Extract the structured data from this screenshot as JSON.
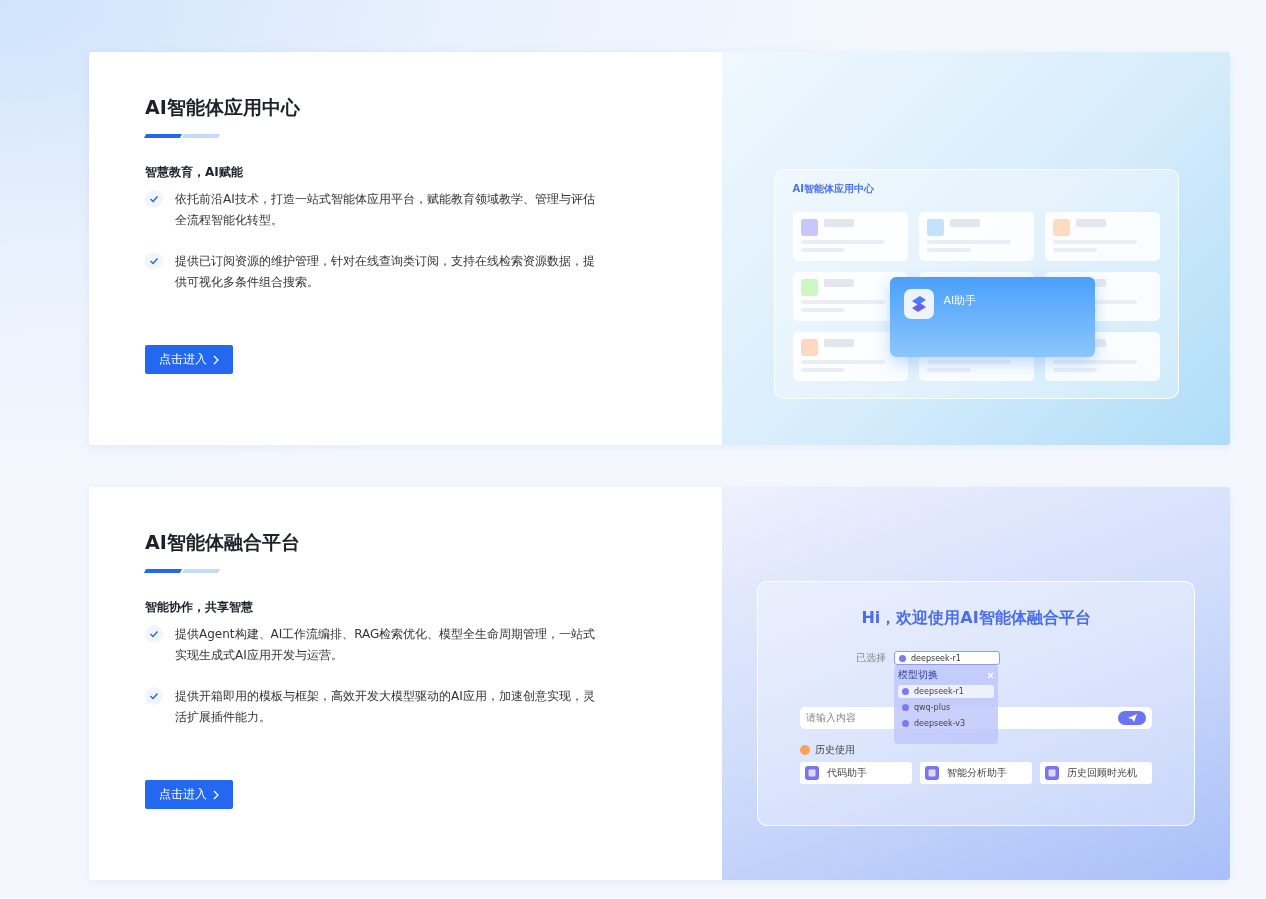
{
  "sections": [
    {
      "title": "AI智能体应用中心",
      "subtitle": "智慧教育，AI赋能",
      "points": [
        "依托前沿AI技术，打造一站式智能体应用平台，赋能教育领域教学、管理与评估全流程智能化转型。",
        "提供已订阅资源的维护管理，针对在线查询类订阅，支持在线检索资源数据，提供可视化多条件组合搜索。"
      ],
      "button": "点击进入",
      "illustration": {
        "kind": "app_grid",
        "heading": "AI智能体应用中心",
        "featured": "AI助手"
      }
    },
    {
      "title": "AI智能体融合平台",
      "subtitle": "智能协作，共享智慧",
      "points": [
        "提供Agent构建、AI工作流编排、RAG检索优化、模型全生命周期管理，一站式实现生成式AI应用开发与运营。",
        "提供开箱即用的模板与框架，高效开发大模型驱动的AI应用，加速创意实现，灵活扩展插件能力。"
      ],
      "button": "点击进入",
      "illustration": {
        "kind": "chat",
        "greeting": "Hi，欢迎使用AI智能体融合平台",
        "selected_label": "已选择",
        "selected_model": "deepseek-r1",
        "dropdown_title": "模型切换",
        "models": [
          {
            "name": "deepseek-r1",
            "selected": true
          },
          {
            "name": "qwq-plus",
            "selected": false
          },
          {
            "name": "deepseek-v3",
            "selected": false
          }
        ],
        "input_placeholder": "请输入内容",
        "history_label": "历史使用",
        "history": [
          "代码助手",
          "智能分析助手",
          "历史回顾时光机"
        ]
      }
    }
  ]
}
